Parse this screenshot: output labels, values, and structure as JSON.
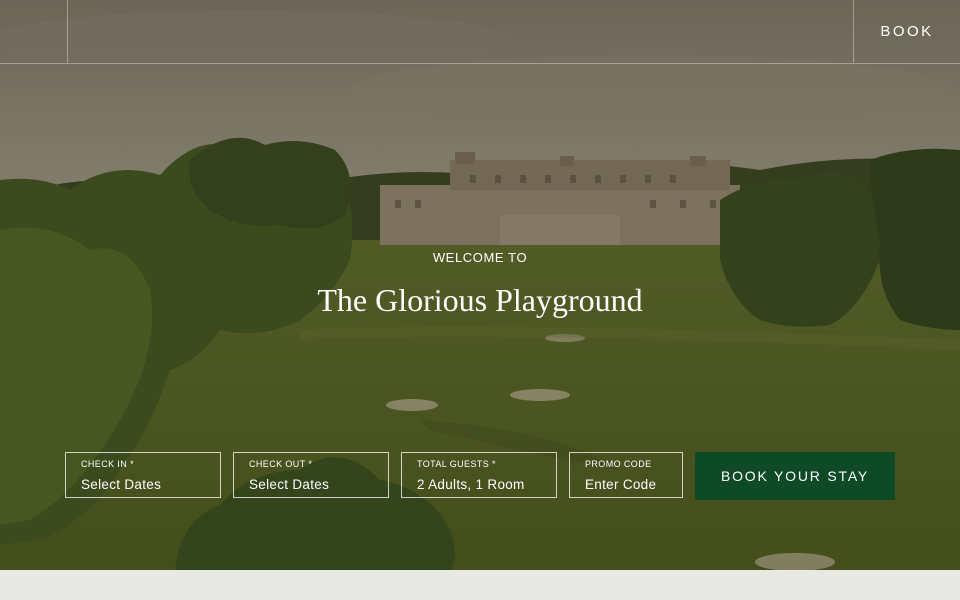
{
  "header": {
    "book_label": "BOOK"
  },
  "hero": {
    "eyebrow": "WELCOME TO",
    "title": "The Glorious Playground"
  },
  "booking": {
    "check_in": {
      "label": "CHECK IN *",
      "value": "Select Dates"
    },
    "check_out": {
      "label": "CHECK OUT *",
      "value": "Select Dates"
    },
    "guests": {
      "label": "TOTAL GUESTS *",
      "value": "2 Adults, 1 Room"
    },
    "promo": {
      "label": "PROMO CODE",
      "placeholder": "Enter Code"
    },
    "submit_label": "BOOK YOUR STAY"
  },
  "colors": {
    "accent_green": "#0e4a26",
    "footer_band": "#e8e8e4"
  }
}
